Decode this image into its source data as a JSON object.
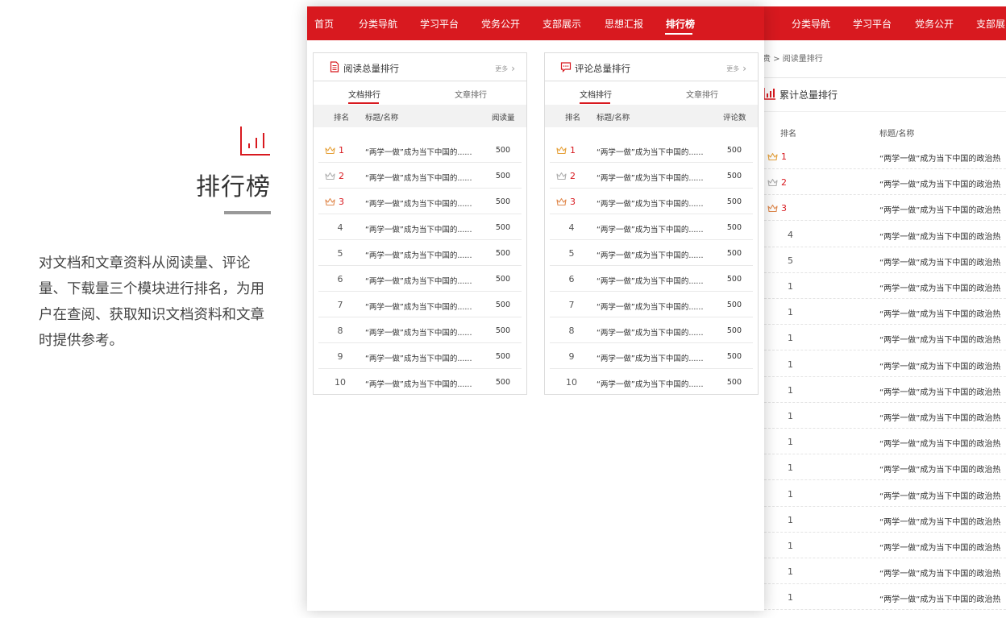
{
  "intro": {
    "title": "排行榜",
    "description": "对文档和文章资料从阅读量、评论量、下载量三个模块进行排名，为用户在查阅、获取知识文档资料和文章时提供参考。",
    "icon": "bar-chart-icon"
  },
  "nav": {
    "items": [
      "首页",
      "分类导航",
      "学习平台",
      "党务公开",
      "支部展示",
      "思想汇报",
      "排行榜"
    ],
    "active": "排行榜"
  },
  "panels": [
    {
      "title": "阅读总量排行",
      "icon": "document-icon",
      "more": "更多",
      "tabs": [
        "文档排行",
        "文章排行"
      ],
      "active_tab": "文档排行",
      "columns": [
        "排名",
        "标题/名称",
        "阅读量"
      ],
      "rows": [
        {
          "rank": "1",
          "title": "“两学一做”成为当下中国的......",
          "value": "500",
          "medal": "gold"
        },
        {
          "rank": "2",
          "title": "“两学一做”成为当下中国的......",
          "value": "500",
          "medal": "silver"
        },
        {
          "rank": "3",
          "title": "“两学一做”成为当下中国的......",
          "value": "500",
          "medal": "bronze"
        },
        {
          "rank": "4",
          "title": "“两学一做”成为当下中国的......",
          "value": "500"
        },
        {
          "rank": "5",
          "title": "“两学一做”成为当下中国的......",
          "value": "500"
        },
        {
          "rank": "6",
          "title": "“两学一做”成为当下中国的......",
          "value": "500"
        },
        {
          "rank": "7",
          "title": "“两学一做”成为当下中国的......",
          "value": "500"
        },
        {
          "rank": "8",
          "title": "“两学一做”成为当下中国的......",
          "value": "500"
        },
        {
          "rank": "9",
          "title": "“两学一做”成为当下中国的......",
          "value": "500"
        },
        {
          "rank": "10",
          "title": "“两学一做”成为当下中国的......",
          "value": "500"
        }
      ]
    },
    {
      "title": "评论总量排行",
      "icon": "comment-icon",
      "more": "更多",
      "tabs": [
        "文档排行",
        "文章排行"
      ],
      "active_tab": "文档排行",
      "columns": [
        "排名",
        "标题/名称",
        "评论数"
      ],
      "rows": [
        {
          "rank": "1",
          "title": "“两学一做”成为当下中国的......",
          "value": "500",
          "medal": "gold"
        },
        {
          "rank": "2",
          "title": "“两学一做”成为当下中国的......",
          "value": "500",
          "medal": "silver"
        },
        {
          "rank": "3",
          "title": "“两学一做”成为当下中国的......",
          "value": "500",
          "medal": "bronze"
        },
        {
          "rank": "4",
          "title": "“两学一做”成为当下中国的......",
          "value": "500"
        },
        {
          "rank": "5",
          "title": "“两学一做”成为当下中国的......",
          "value": "500"
        },
        {
          "rank": "6",
          "title": "“两学一做”成为当下中国的......",
          "value": "500"
        },
        {
          "rank": "7",
          "title": "“两学一做”成为当下中国的......",
          "value": "500"
        },
        {
          "rank": "8",
          "title": "“两学一做”成为当下中国的......",
          "value": "500"
        },
        {
          "rank": "9",
          "title": "“两学一做”成为当下中国的......",
          "value": "500"
        },
        {
          "rank": "10",
          "title": "“两学一做”成为当下中国的......",
          "value": "500"
        }
      ]
    }
  ],
  "back_page": {
    "nav_items": [
      "分类导航",
      "学习平台",
      "党务公开",
      "支部展"
    ],
    "breadcrumb": "贵 > 阅读量排行",
    "heading": "累计总量排行",
    "columns": [
      "排名",
      "标题/名称"
    ],
    "rows": [
      {
        "rank": "1",
        "title": "“两学一做”成为当下中国的政治热",
        "medal": "gold"
      },
      {
        "rank": "2",
        "title": "“两学一做”成为当下中国的政治热",
        "medal": "silver"
      },
      {
        "rank": "3",
        "title": "“两学一做”成为当下中国的政治热",
        "medal": "bronze"
      },
      {
        "rank": "4",
        "title": "“两学一做”成为当下中国的政治热"
      },
      {
        "rank": "5",
        "title": "“两学一做”成为当下中国的政治热"
      },
      {
        "rank": "1",
        "title": "“两学一做”成为当下中国的政治热"
      },
      {
        "rank": "1",
        "title": "“两学一做”成为当下中国的政治热"
      },
      {
        "rank": "1",
        "title": "“两学一做”成为当下中国的政治热"
      },
      {
        "rank": "1",
        "title": "“两学一做”成为当下中国的政治热"
      },
      {
        "rank": "1",
        "title": "“两学一做”成为当下中国的政治热"
      },
      {
        "rank": "1",
        "title": "“两学一做”成为当下中国的政治热"
      },
      {
        "rank": "1",
        "title": "“两学一做”成为当下中国的政治热"
      },
      {
        "rank": "1",
        "title": "“两学一做”成为当下中国的政治热"
      },
      {
        "rank": "1",
        "title": "“两学一做”成为当下中国的政治热"
      },
      {
        "rank": "1",
        "title": "“两学一做”成为当下中国的政治热"
      },
      {
        "rank": "1",
        "title": "“两学一做”成为当下中国的政治热"
      },
      {
        "rank": "1",
        "title": "“两学一做”成为当下中国的政治热"
      },
      {
        "rank": "1",
        "title": "“两学一做”成为当下中国的政治热"
      }
    ]
  },
  "colors": {
    "brand_red": "#d8191f",
    "gold": "#e6a23c",
    "silver": "#b0b0b0",
    "bronze": "#e08a4f"
  }
}
